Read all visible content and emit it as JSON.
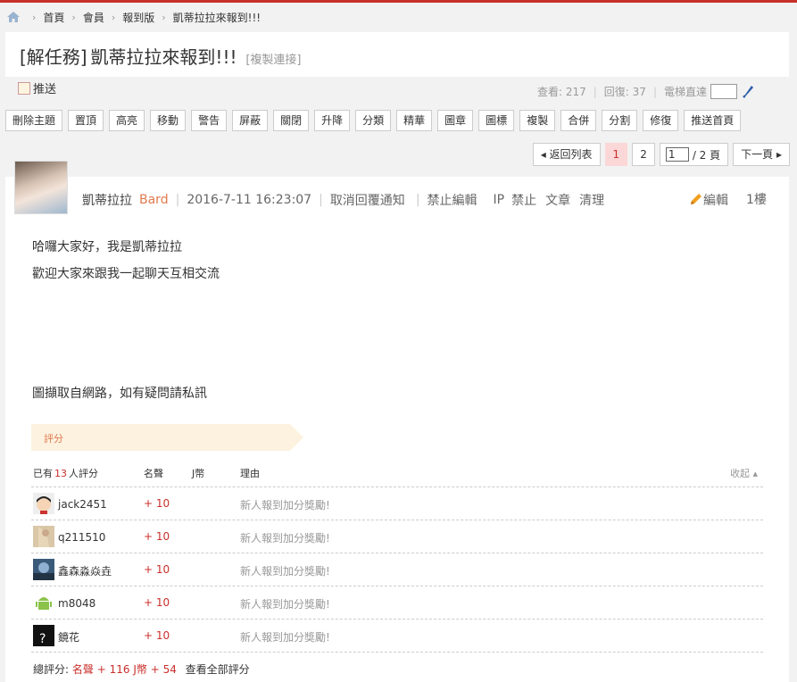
{
  "breadcrumb": [
    "首頁",
    "會員",
    "報到版",
    "凱蒂拉拉來報到!!!"
  ],
  "thread": {
    "prefix": "[解任務]",
    "title": "凱蒂拉拉來報到!!!",
    "copy_link": "[複製連接]"
  },
  "push_label": "推送",
  "stats": {
    "views": "查看: 217",
    "replies": "回復: 37",
    "jump_label": "電梯直達"
  },
  "mod_buttons": [
    "刪除主題",
    "置頂",
    "高亮",
    "移動",
    "警告",
    "屏蔽",
    "關閉",
    "升降",
    "分類",
    "精華",
    "圖章",
    "圖標",
    "複製",
    "合併",
    "分割",
    "修復",
    "推送首頁"
  ],
  "pager": {
    "back": "返回列表",
    "pages": [
      "1",
      "2"
    ],
    "current": "1",
    "input_value": "1",
    "total": "/ 2 頁",
    "next": "下一頁"
  },
  "post": {
    "author": "凱蒂拉拉",
    "rank": "Bard",
    "datetime": "2016-7-11 16:23:07",
    "actions": [
      "取消回覆通知",
      "禁止編輯",
      "IP",
      "禁止",
      "文章",
      "清理"
    ],
    "edit_label": "編輯",
    "floor": "1樓",
    "lines": [
      "哈囉大家好，我是凱蒂拉拉",
      "歡迎大家來跟我一起聊天互相交流"
    ],
    "note": "圖擷取自網路，如有疑問請私訊"
  },
  "rating": {
    "section_label": "評分",
    "header": {
      "prefix": "已有",
      "count": "13",
      "suffix": "人評分",
      "col_rep": "名聲",
      "col_j": "J幣",
      "col_reason": "理由",
      "collapse": "收起"
    },
    "rows": [
      {
        "user": "jack2451",
        "rep": "+ 10",
        "reason": "新人報到加分獎勵!"
      },
      {
        "user": "q211510",
        "rep": "+ 10",
        "reason": "新人報到加分獎勵!"
      },
      {
        "user": "鑫森淼焱垚",
        "rep": "+ 10",
        "reason": "新人報到加分獎勵!"
      },
      {
        "user": "m8048",
        "rep": "+ 10",
        "reason": "新人報到加分獎勵!"
      },
      {
        "user": "鏡花",
        "rep": "+ 10",
        "reason": "新人報到加分獎勵!"
      }
    ],
    "summary": {
      "label": "總評分:",
      "rep_label": "名聲",
      "rep_value": "+ 116",
      "j_label": "J幣",
      "j_value": "+ 54",
      "view_all": "查看全部評分"
    }
  },
  "colors": {
    "accent": "#c9302c",
    "rank": "#e07a4f",
    "rate_bg": "#fdf2e0"
  }
}
